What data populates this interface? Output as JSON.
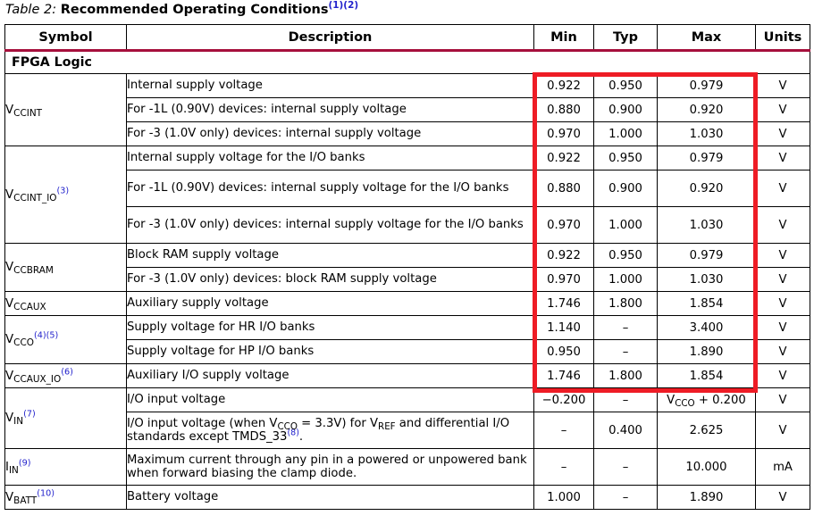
{
  "caption": {
    "label": "Table  2:",
    "title": "Recommended Operating Conditions",
    "footnotes": "(1)(2)"
  },
  "table": {
    "columns": [
      "Symbol",
      "Description",
      "Min",
      "Typ",
      "Max",
      "Units"
    ],
    "section_label": "FPGA Logic",
    "dash": "–",
    "rows": [
      {
        "symbol": "V",
        "symbol_sub": "CCINT",
        "symbol_fn": "",
        "description": "Internal supply voltage",
        "min": "0.922",
        "typ": "0.950",
        "max": "0.979",
        "units": "V"
      },
      {
        "symbol": "",
        "symbol_sub": "",
        "symbol_fn": "",
        "description": "For -1L (0.90V) devices: internal supply voltage",
        "min": "0.880",
        "typ": "0.900",
        "max": "0.920",
        "units": "V"
      },
      {
        "symbol": "",
        "symbol_sub": "",
        "symbol_fn": "",
        "description": "For -3 (1.0V only) devices: internal supply voltage",
        "min": "0.970",
        "typ": "1.000",
        "max": "1.030",
        "units": "V"
      },
      {
        "symbol": "V",
        "symbol_sub": "CCINT_IO",
        "symbol_fn": "(3)",
        "description": "Internal supply voltage for the I/O banks",
        "min": "0.922",
        "typ": "0.950",
        "max": "0.979",
        "units": "V"
      },
      {
        "symbol": "",
        "symbol_sub": "",
        "symbol_fn": "",
        "description": "For -1L (0.90V) devices: internal supply voltage for the I/O banks",
        "min": "0.880",
        "typ": "0.900",
        "max": "0.920",
        "units": "V"
      },
      {
        "symbol": "",
        "symbol_sub": "",
        "symbol_fn": "",
        "description": "For -3 (1.0V only) devices: internal supply voltage for the I/O banks",
        "min": "0.970",
        "typ": "1.000",
        "max": "1.030",
        "units": "V"
      },
      {
        "symbol": "V",
        "symbol_sub": "CCBRAM",
        "symbol_fn": "",
        "description": "Block RAM supply voltage",
        "min": "0.922",
        "typ": "0.950",
        "max": "0.979",
        "units": "V"
      },
      {
        "symbol": "",
        "symbol_sub": "",
        "symbol_fn": "",
        "description": "For -3 (1.0V only) devices: block RAM supply voltage",
        "min": "0.970",
        "typ": "1.000",
        "max": "1.030",
        "units": "V"
      },
      {
        "symbol": "V",
        "symbol_sub": "CCAUX",
        "symbol_fn": "",
        "description": "Auxiliary supply voltage",
        "min": "1.746",
        "typ": "1.800",
        "max": "1.854",
        "units": "V"
      },
      {
        "symbol": "V",
        "symbol_sub": "CCO",
        "symbol_fn": "(4)(5)",
        "description": "Supply voltage for HR I/O banks",
        "min": "1.140",
        "typ": "–",
        "max": "3.400",
        "units": "V"
      },
      {
        "symbol": "",
        "symbol_sub": "",
        "symbol_fn": "",
        "description": "Supply voltage for HP I/O banks",
        "min": "0.950",
        "typ": "–",
        "max": "1.890",
        "units": "V"
      },
      {
        "symbol": "V",
        "symbol_sub": "CCAUX_IO",
        "symbol_fn": "(6)",
        "description": "Auxiliary I/O supply voltage",
        "min": "1.746",
        "typ": "1.800",
        "max": "1.854",
        "units": "V"
      },
      {
        "symbol": "V",
        "symbol_sub": "IN",
        "symbol_fn": "(7)",
        "description": "I/O input voltage",
        "min": "−0.200",
        "typ": "–",
        "max": "VCCO + 0.200",
        "units": "V"
      },
      {
        "symbol": "",
        "symbol_sub": "",
        "symbol_fn": "",
        "description": "I/O input voltage (when VCCO = 3.3V) for VREF and differential I/O standards except TMDS_33(8).",
        "min": "–",
        "typ": "0.400",
        "max": "2.625",
        "units": "V"
      },
      {
        "symbol": "I",
        "symbol_sub": "IN",
        "symbol_fn": "(9)",
        "description": "Maximum current through any pin in a powered or unpowered bank when forward biasing the clamp diode.",
        "min": "–",
        "typ": "–",
        "max": "10.000",
        "units": "mA"
      },
      {
        "symbol": "V",
        "symbol_sub": "BATT",
        "symbol_fn": "(10)",
        "description": "Battery voltage",
        "min": "1.000",
        "typ": "–",
        "max": "1.890",
        "units": "V"
      }
    ]
  },
  "annotation": {
    "highlight_color": "#ee1c25",
    "header_rule_color": "#a60f3c",
    "footnote_color": "#2222cc",
    "highlight_description": "red box around Min/Typ/Max values for FPGA Logic supply rows"
  }
}
